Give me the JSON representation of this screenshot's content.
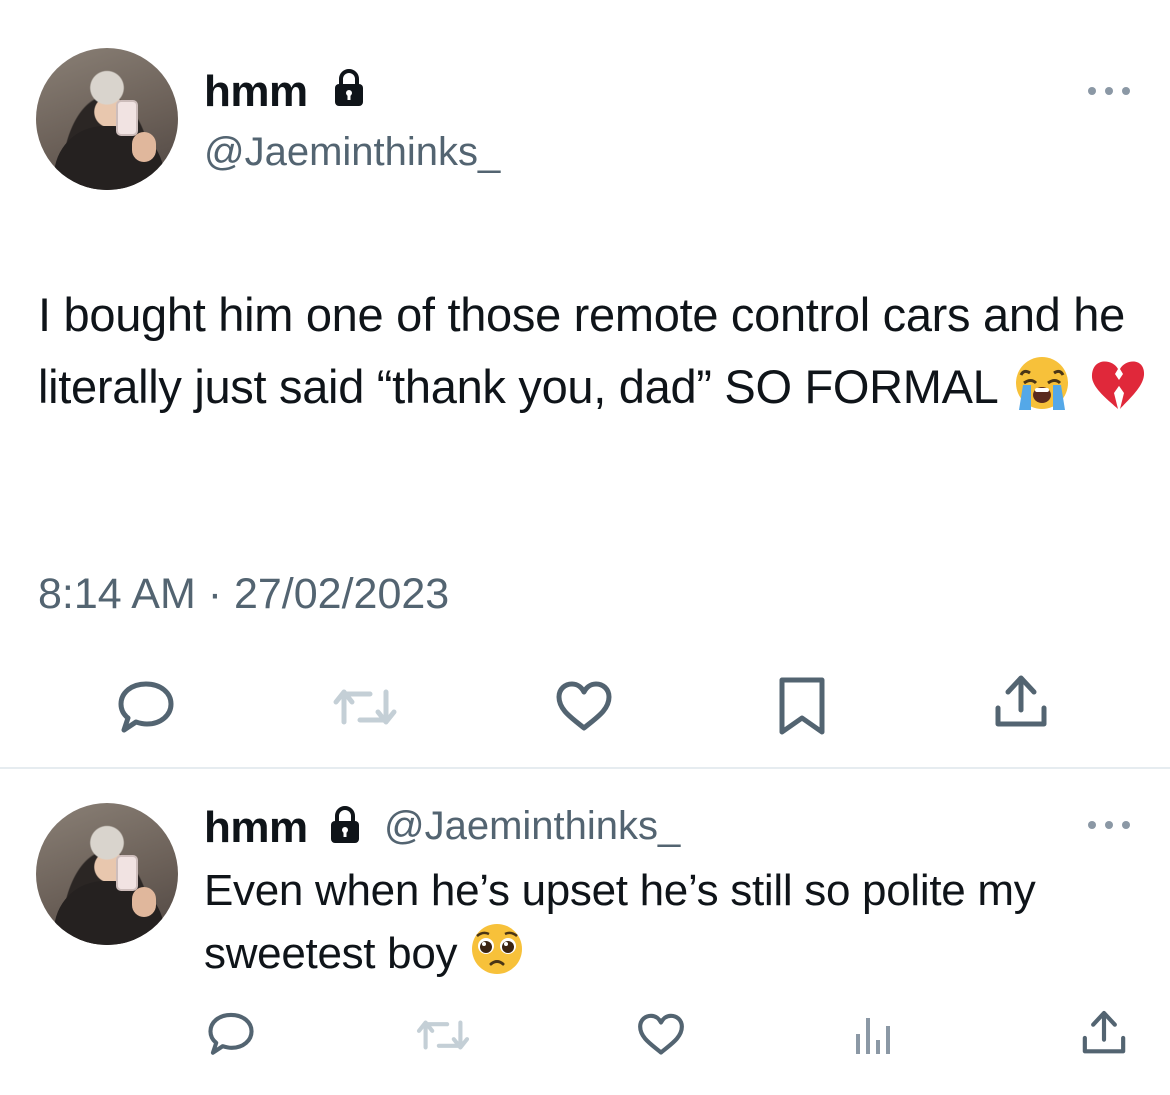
{
  "main_tweet": {
    "display_name": "hmm",
    "handle": "@Jaeminthinks_",
    "text": "I bought him one of those remote control cars and he literally just said “thank you, dad” SO FORMAL",
    "emojis": [
      "loudly-crying-face",
      "broken-heart"
    ],
    "timestamp": "8:14 AM · 27/02/2023",
    "actions": [
      "reply-icon",
      "retweet-icon",
      "like-icon",
      "bookmark-icon",
      "share-icon"
    ]
  },
  "reply_tweet": {
    "display_name": "hmm",
    "handle": "@Jaeminthinks_",
    "text": "Even when he’s upset he’s still so polite my sweetest boy",
    "emojis": [
      "pleading-face"
    ],
    "actions": [
      "reply-icon",
      "retweet-icon",
      "like-icon",
      "views-icon",
      "share-icon"
    ]
  },
  "colors": {
    "text_primary": "#0f1419",
    "text_secondary": "#536471",
    "icon_gray": "#536471",
    "retweet_disabled": "#c4cfd6",
    "divider": "#e6ecf0"
  }
}
